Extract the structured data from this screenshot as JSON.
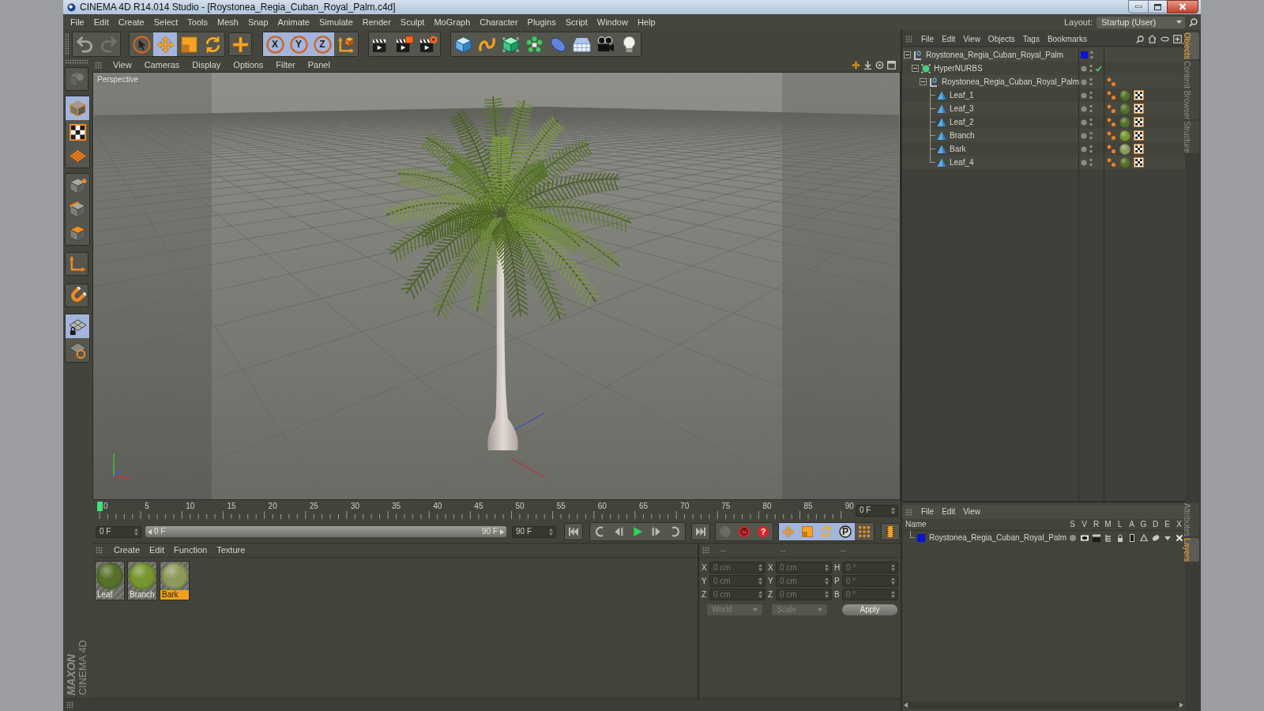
{
  "window": {
    "title": "CINEMA 4D R14.014 Studio - [Roystonea_Regia_Cuban_Royal_Palm.c4d]"
  },
  "menu_bar": [
    "File",
    "Edit",
    "Create",
    "Select",
    "Tools",
    "Mesh",
    "Snap",
    "Animate",
    "Simulate",
    "Render",
    "Sculpt",
    "MoGraph",
    "Character",
    "Plugins",
    "Script",
    "Window",
    "Help"
  ],
  "layout": {
    "label": "Layout:",
    "value": "Startup (User)"
  },
  "main_toolbar": [
    [
      {
        "selected": false,
        "disabled": false
      },
      {
        "selected": false,
        "disabled": true
      }
    ],
    [
      {
        "selected": false,
        "disabled": false
      },
      {
        "selected": true,
        "disabled": false
      },
      {
        "selected": false,
        "disabled": false
      },
      {
        "selected": false,
        "disabled": false
      }
    ],
    [
      {
        "selected": false,
        "disabled": false
      }
    ],
    [
      {
        "label": "X",
        "selected": true,
        "disabled": false
      },
      {
        "label": "Y",
        "selected": true,
        "disabled": false
      },
      {
        "label": "Z",
        "selected": true,
        "disabled": false
      },
      {
        "selected": false,
        "disabled": false
      }
    ],
    [
      {
        "selected": false,
        "disabled": false
      },
      {
        "selected": false,
        "disabled": false
      },
      {
        "selected": false,
        "disabled": false
      }
    ],
    [
      {
        "selected": false,
        "disabled": false
      },
      {
        "selected": false,
        "disabled": false
      },
      {
        "selected": false,
        "disabled": false
      },
      {
        "selected": false,
        "disabled": false
      },
      {
        "selected": false,
        "disabled": false
      },
      {
        "selected": false,
        "disabled": false
      },
      {
        "selected": false,
        "disabled": false
      },
      {
        "selected": false,
        "disabled": false
      }
    ]
  ],
  "mode_toolbar": [
    [
      {
        "selected": false,
        "disabled": true
      }
    ],
    [
      {
        "selected": true,
        "disabled": false
      },
      {
        "selected": false,
        "disabled": false
      },
      {
        "selected": false,
        "disabled": false
      }
    ],
    [
      {
        "selected": false,
        "disabled": false
      },
      {
        "selected": false,
        "disabled": false
      },
      {
        "selected": false,
        "disabled": false
      }
    ],
    [
      {
        "selected": false,
        "disabled": false
      }
    ],
    [
      {
        "selected": false,
        "disabled": false
      }
    ],
    [
      {
        "selected": true,
        "disabled": false
      },
      {
        "selected": false,
        "disabled": false
      }
    ]
  ],
  "viewport": {
    "menu": [
      "View",
      "Cameras",
      "Display",
      "Options",
      "Filter",
      "Panel"
    ],
    "camera": "Perspective"
  },
  "timeline": {
    "ticks": [
      "0",
      "5",
      "10",
      "15",
      "20",
      "25",
      "30",
      "35",
      "40",
      "45",
      "50",
      "55",
      "60",
      "65",
      "70",
      "75",
      "80",
      "85",
      "90"
    ],
    "playhead": {
      "level": 0
    },
    "current_frame": "0 F"
  },
  "playback": {
    "start_frame": "0 F",
    "range": {
      "start": "0 F",
      "end": "90 F",
      "level": 1
    },
    "end_frame": "90 F",
    "buttons": [
      [
        {
          "selected": false,
          "disabled": false
        }
      ],
      [
        {
          "selected": false,
          "disabled": false
        },
        {
          "selected": false,
          "disabled": false
        },
        {
          "selected": false,
          "disabled": false
        },
        {
          "selected": false,
          "disabled": false
        },
        {
          "selected": false,
          "disabled": false
        }
      ],
      [
        {
          "selected": false,
          "disabled": false
        }
      ],
      [
        {
          "selected": false,
          "disabled": true
        },
        {
          "selected": false,
          "disabled": false
        },
        {
          "label": "?",
          "selected": false,
          "disabled": false
        }
      ],
      [
        {
          "selected": true,
          "disabled": false
        },
        {
          "selected": true,
          "disabled": false
        },
        {
          "selected": true,
          "disabled": false
        },
        {
          "label": "P",
          "selected": true,
          "disabled": false
        },
        {
          "selected": false,
          "disabled": false
        }
      ],
      [
        {
          "selected": false,
          "disabled": false
        }
      ]
    ]
  },
  "materials": {
    "menu": [
      "Create",
      "Edit",
      "Function",
      "Texture"
    ],
    "items": [
      {
        "name": "Leaf",
        "color": "#55702a",
        "selected": false
      },
      {
        "name": "Branch",
        "color": "#76962f",
        "selected": false
      },
      {
        "name": "Bark",
        "color": "#8d9a5a",
        "selected": true
      }
    ]
  },
  "coordinates": {
    "headers": [
      "--",
      "--",
      "--"
    ],
    "columns": [
      [
        {
          "axis": "X",
          "value": "0 cm"
        },
        {
          "axis": "Y",
          "value": "0 cm"
        },
        {
          "axis": "Z",
          "value": "0 cm"
        }
      ],
      [
        {
          "axis": "X",
          "value": "0 cm"
        },
        {
          "axis": "Y",
          "value": "0 cm"
        },
        {
          "axis": "Z",
          "value": "0 cm"
        }
      ],
      [
        {
          "axis": "H",
          "value": "0 °"
        },
        {
          "axis": "P",
          "value": "0 °"
        },
        {
          "axis": "B",
          "value": "0 °"
        }
      ]
    ],
    "disabled": true,
    "mode": "World",
    "transform": "Scale",
    "apply": "Apply"
  },
  "object_manager": {
    "menu": [
      "File",
      "Edit",
      "View",
      "Objects",
      "Tags",
      "Bookmarks"
    ],
    "tree": [
      {
        "name": "Roystonea_Regia_Cuban_Royal_Palm",
        "kind": "null",
        "expanded": true,
        "color": "#0a14d2",
        "children": [
          {
            "name": "HyperNURBS",
            "kind": "nurbs",
            "expanded": true,
            "enabled": true,
            "children": [
              {
                "name": "Roystonea_Regia_Cuban_Royal_Palm",
                "kind": "null",
                "expanded": true,
                "tags": [
                  {
                    "kind": "dots"
                  }
                ],
                "children": [
                  {
                    "name": "Leaf_1",
                    "kind": "polygon",
                    "tags": [
                      {
                        "kind": "dots"
                      },
                      {
                        "kind": "material",
                        "color": "#55702a"
                      },
                      {
                        "kind": "uvw"
                      }
                    ]
                  },
                  {
                    "name": "Leaf_3",
                    "kind": "polygon",
                    "tags": [
                      {
                        "kind": "dots"
                      },
                      {
                        "kind": "material",
                        "color": "#55702a"
                      },
                      {
                        "kind": "uvw"
                      }
                    ]
                  },
                  {
                    "name": "Leaf_2",
                    "kind": "polygon",
                    "tags": [
                      {
                        "kind": "dots"
                      },
                      {
                        "kind": "material",
                        "color": "#55702a"
                      },
                      {
                        "kind": "uvw"
                      }
                    ]
                  },
                  {
                    "name": "Branch",
                    "kind": "polygon",
                    "tags": [
                      {
                        "kind": "dots"
                      },
                      {
                        "kind": "material",
                        "color": "#76962f"
                      },
                      {
                        "kind": "uvw"
                      }
                    ]
                  },
                  {
                    "name": "Bark",
                    "kind": "polygon",
                    "tags": [
                      {
                        "kind": "dots"
                      },
                      {
                        "kind": "material",
                        "color": "#8d9a5a"
                      },
                      {
                        "kind": "uvw"
                      }
                    ]
                  },
                  {
                    "name": "Leaf_4",
                    "kind": "polygon",
                    "tags": [
                      {
                        "kind": "dots"
                      },
                      {
                        "kind": "material",
                        "color": "#55702a"
                      },
                      {
                        "kind": "uvw"
                      }
                    ]
                  }
                ]
              }
            ]
          }
        ]
      }
    ]
  },
  "layer_manager": {
    "menu": [
      "File",
      "Edit",
      "View"
    ],
    "columns": [
      "Name",
      "S",
      "V",
      "R",
      "M",
      "L",
      "A",
      "G",
      "D",
      "E",
      "X"
    ],
    "layers": [
      {
        "name": "Roystonea_Regia_Cuban_Royal_Palm",
        "color": "#0a14d2"
      }
    ]
  },
  "side_tabs": {
    "top": [
      {
        "label": "Objects",
        "selected": true
      },
      {
        "label": "Content Browser",
        "selected": false
      },
      {
        "label": "Structure",
        "selected": false
      }
    ],
    "bottom": [
      {
        "label": "Attributes",
        "selected": false
      },
      {
        "label": "Layers",
        "selected": true
      }
    ]
  },
  "logo": {
    "brand": "MAXON",
    "product": "CINEMA 4D"
  }
}
